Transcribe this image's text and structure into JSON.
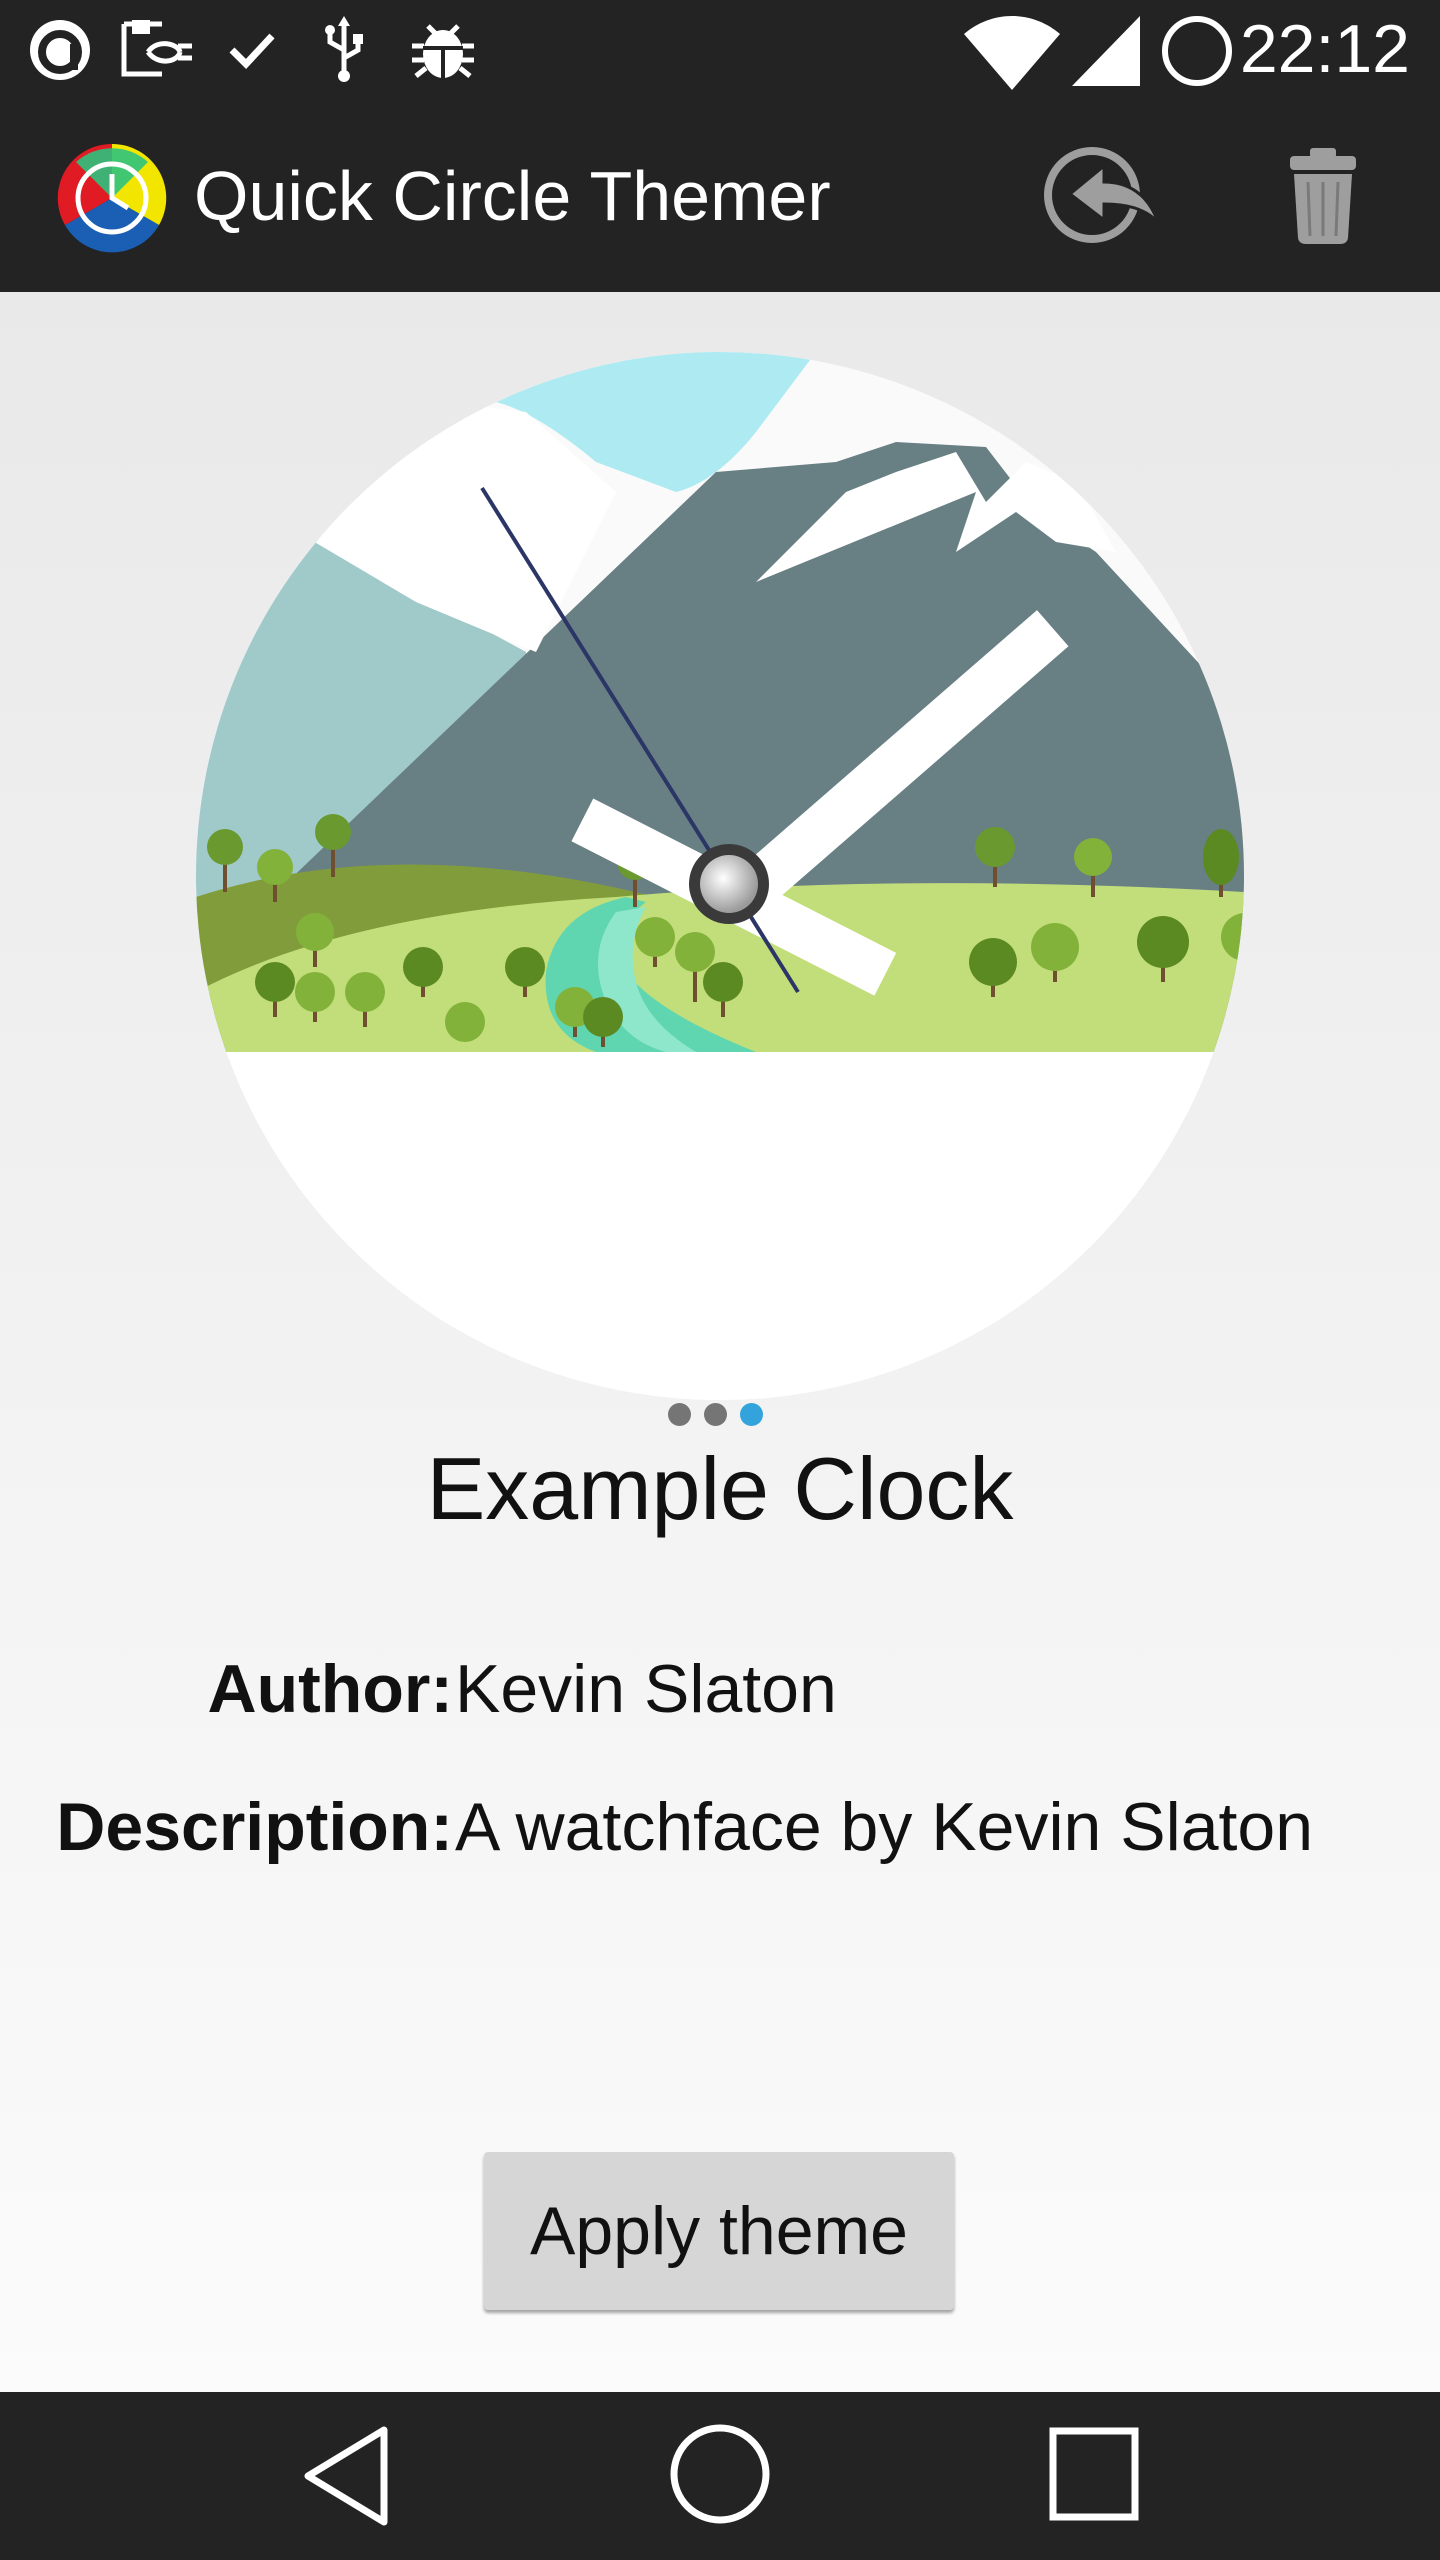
{
  "status_bar": {
    "time": "22:12",
    "left_icons": [
      "notification-circle-icon",
      "display-plug-icon",
      "check-icon",
      "usb-icon",
      "bug-icon"
    ],
    "right_icons": [
      "wifi-icon",
      "signal-icon",
      "battery-circle-icon"
    ]
  },
  "app_bar": {
    "title": "Quick Circle Themer",
    "logo_icon": "quick-circle-logo-icon",
    "actions": [
      "share-icon",
      "trash-icon"
    ]
  },
  "theme": {
    "name": "Example Clock",
    "author_label": "Author:",
    "author": "Kevin Slaton",
    "description_label": "Description:",
    "description": "A watchface by Kevin Slaton",
    "page_count": 3,
    "active_page": 3
  },
  "apply_button": {
    "label": "Apply theme"
  },
  "nav_bar": {
    "icons": [
      "back-icon",
      "home-icon",
      "recents-icon"
    ]
  },
  "colors": {
    "bar_background": "#232323",
    "accent_dot": "#33a3dc",
    "button_background": "#d6d6d6"
  }
}
